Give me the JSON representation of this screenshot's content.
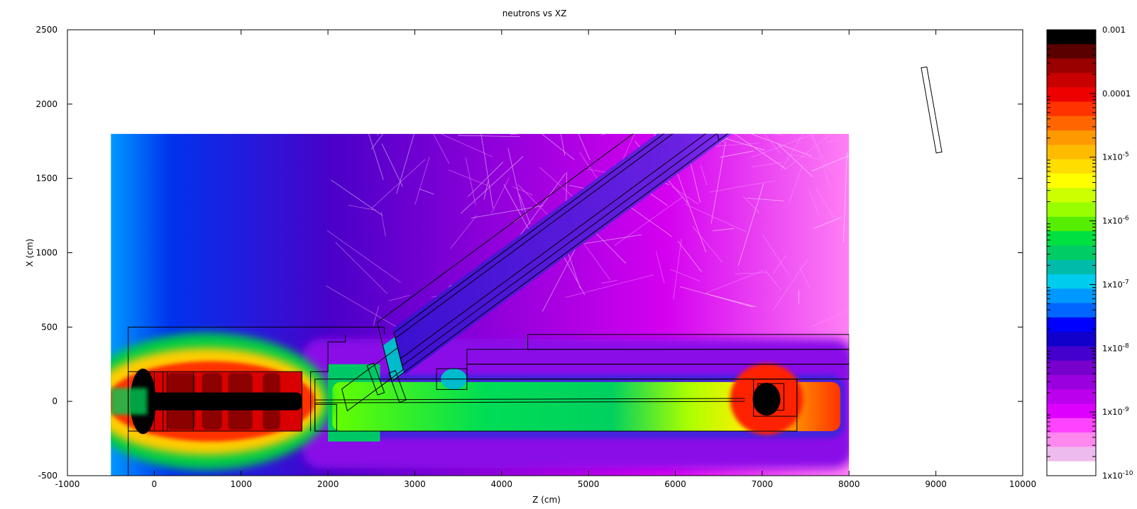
{
  "chart_data": {
    "type": "heatmap",
    "title": "neutrons vs XZ",
    "xlabel": "Z (cm)",
    "ylabel": "X (cm)",
    "xlim": [
      -1000,
      10000
    ],
    "ylim": [
      -500,
      2500
    ],
    "x_ticks": [
      -1000,
      0,
      1000,
      2000,
      3000,
      4000,
      5000,
      6000,
      7000,
      8000,
      9000,
      10000
    ],
    "y_ticks": [
      -500,
      0,
      500,
      1000,
      1500,
      2000,
      2500
    ],
    "x_tick_labels": [
      "-1000",
      "0",
      "1000",
      "2000",
      "3000",
      "4000",
      "5000",
      "6000",
      "7000",
      "8000",
      "9000",
      "10000"
    ],
    "y_tick_labels": [
      "-500",
      "0",
      "500",
      "1000",
      "1500",
      "2000",
      "2500"
    ],
    "data_extent": {
      "z": [
        -500,
        8000
      ],
      "x": [
        -500,
        1800
      ]
    },
    "grid": false,
    "colorbar": {
      "scale": "log",
      "min": 1e-10,
      "max": 0.001,
      "tick_labels": [
        {
          "value": 0.001,
          "base": "0.001",
          "exp": ""
        },
        {
          "value": 0.0001,
          "base": "0.0001",
          "exp": ""
        },
        {
          "value": 1e-05,
          "base": "1x10",
          "exp": "-5"
        },
        {
          "value": 1e-06,
          "base": "1x10",
          "exp": "-6"
        },
        {
          "value": 1e-07,
          "base": "1x10",
          "exp": "-7"
        },
        {
          "value": 1e-08,
          "base": "1x10",
          "exp": "-8"
        },
        {
          "value": 1e-09,
          "base": "1x10",
          "exp": "-9"
        },
        {
          "value": 1e-10,
          "base": "1x10",
          "exp": "-10"
        }
      ],
      "colors": [
        "#000000",
        "#5a0000",
        "#9b0000",
        "#c80000",
        "#ee0000",
        "#ff3300",
        "#ff6600",
        "#ff9900",
        "#ffbb00",
        "#ffdd00",
        "#ffff00",
        "#ccff00",
        "#99ff00",
        "#55ee00",
        "#00e040",
        "#00cc66",
        "#00bbaa",
        "#00ccee",
        "#0099ff",
        "#0066ff",
        "#0000ff",
        "#1100cc",
        "#4400cc",
        "#7700cc",
        "#9900dd",
        "#bb00ee",
        "#dd00ff",
        "#ff44ff",
        "#ff88ee",
        "#eebbee",
        "#ffffff"
      ]
    },
    "outline_color": "#000000"
  }
}
